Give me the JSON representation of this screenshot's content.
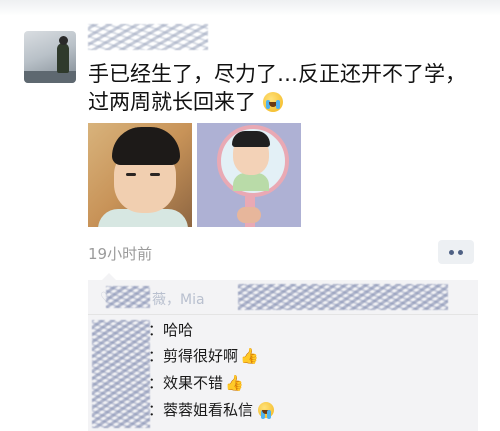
{
  "post": {
    "text_line1": "手已经生了，尽力了…反正还开不了学，",
    "text_line2": "过两周就长回来了",
    "emoji": "crying-laughing-emoji",
    "photos": [
      "photo-child-closeup",
      "photo-child-in-mirror"
    ]
  },
  "meta": {
    "time": "19小时前",
    "more_icon": "more-icon"
  },
  "likes": {
    "icon": "heart-icon",
    "visible_text": "薇，Mia"
  },
  "comments": [
    {
      "text": "：哈哈"
    },
    {
      "text": "：剪得很好啊",
      "emoji": "thumbs-up-emoji"
    },
    {
      "text": "：效果不错",
      "emoji": "thumbs-up-emoji"
    },
    {
      "text": "：蓉蓉姐看私信",
      "emoji": "crying-laughing-emoji"
    }
  ],
  "colors": {
    "accent": "#576b95",
    "comment_bg": "#f3f3f5",
    "time_text": "#9b9b9b"
  }
}
